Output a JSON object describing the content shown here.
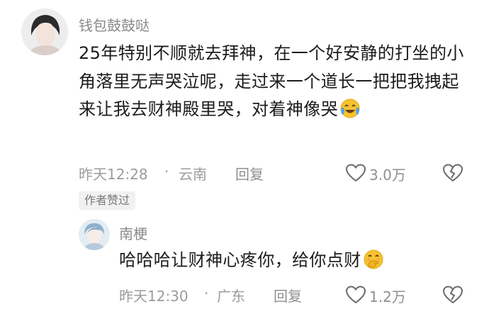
{
  "comment": {
    "username": "钱包鼓鼓哒",
    "content": "25年特别不顺就去拜神，在一个好安静的打坐的小角落里无声哭泣呢，走过来一个道长一把把我拽起来让我去财神殿里哭，对着神像哭",
    "emoji": "crying-laughing-emoji",
    "time": "昨天12:28",
    "separator": "·",
    "location": "云南",
    "reply_label": "回复",
    "likes": "3.0万"
  },
  "badge": "作者赞过",
  "reply": {
    "username": "南梗",
    "content": "哈哈哈让财神心疼你，给你点财",
    "emoji": "hand-over-mouth-emoji",
    "time": "昨天12:30",
    "separator": "·",
    "location": "广东",
    "reply_label": "回复",
    "likes": "1.2万"
  },
  "colors": {
    "meta_text": "#9b9b9b",
    "body_text": "#1c1c1c",
    "emoji_yellow": "#f7c22e"
  }
}
